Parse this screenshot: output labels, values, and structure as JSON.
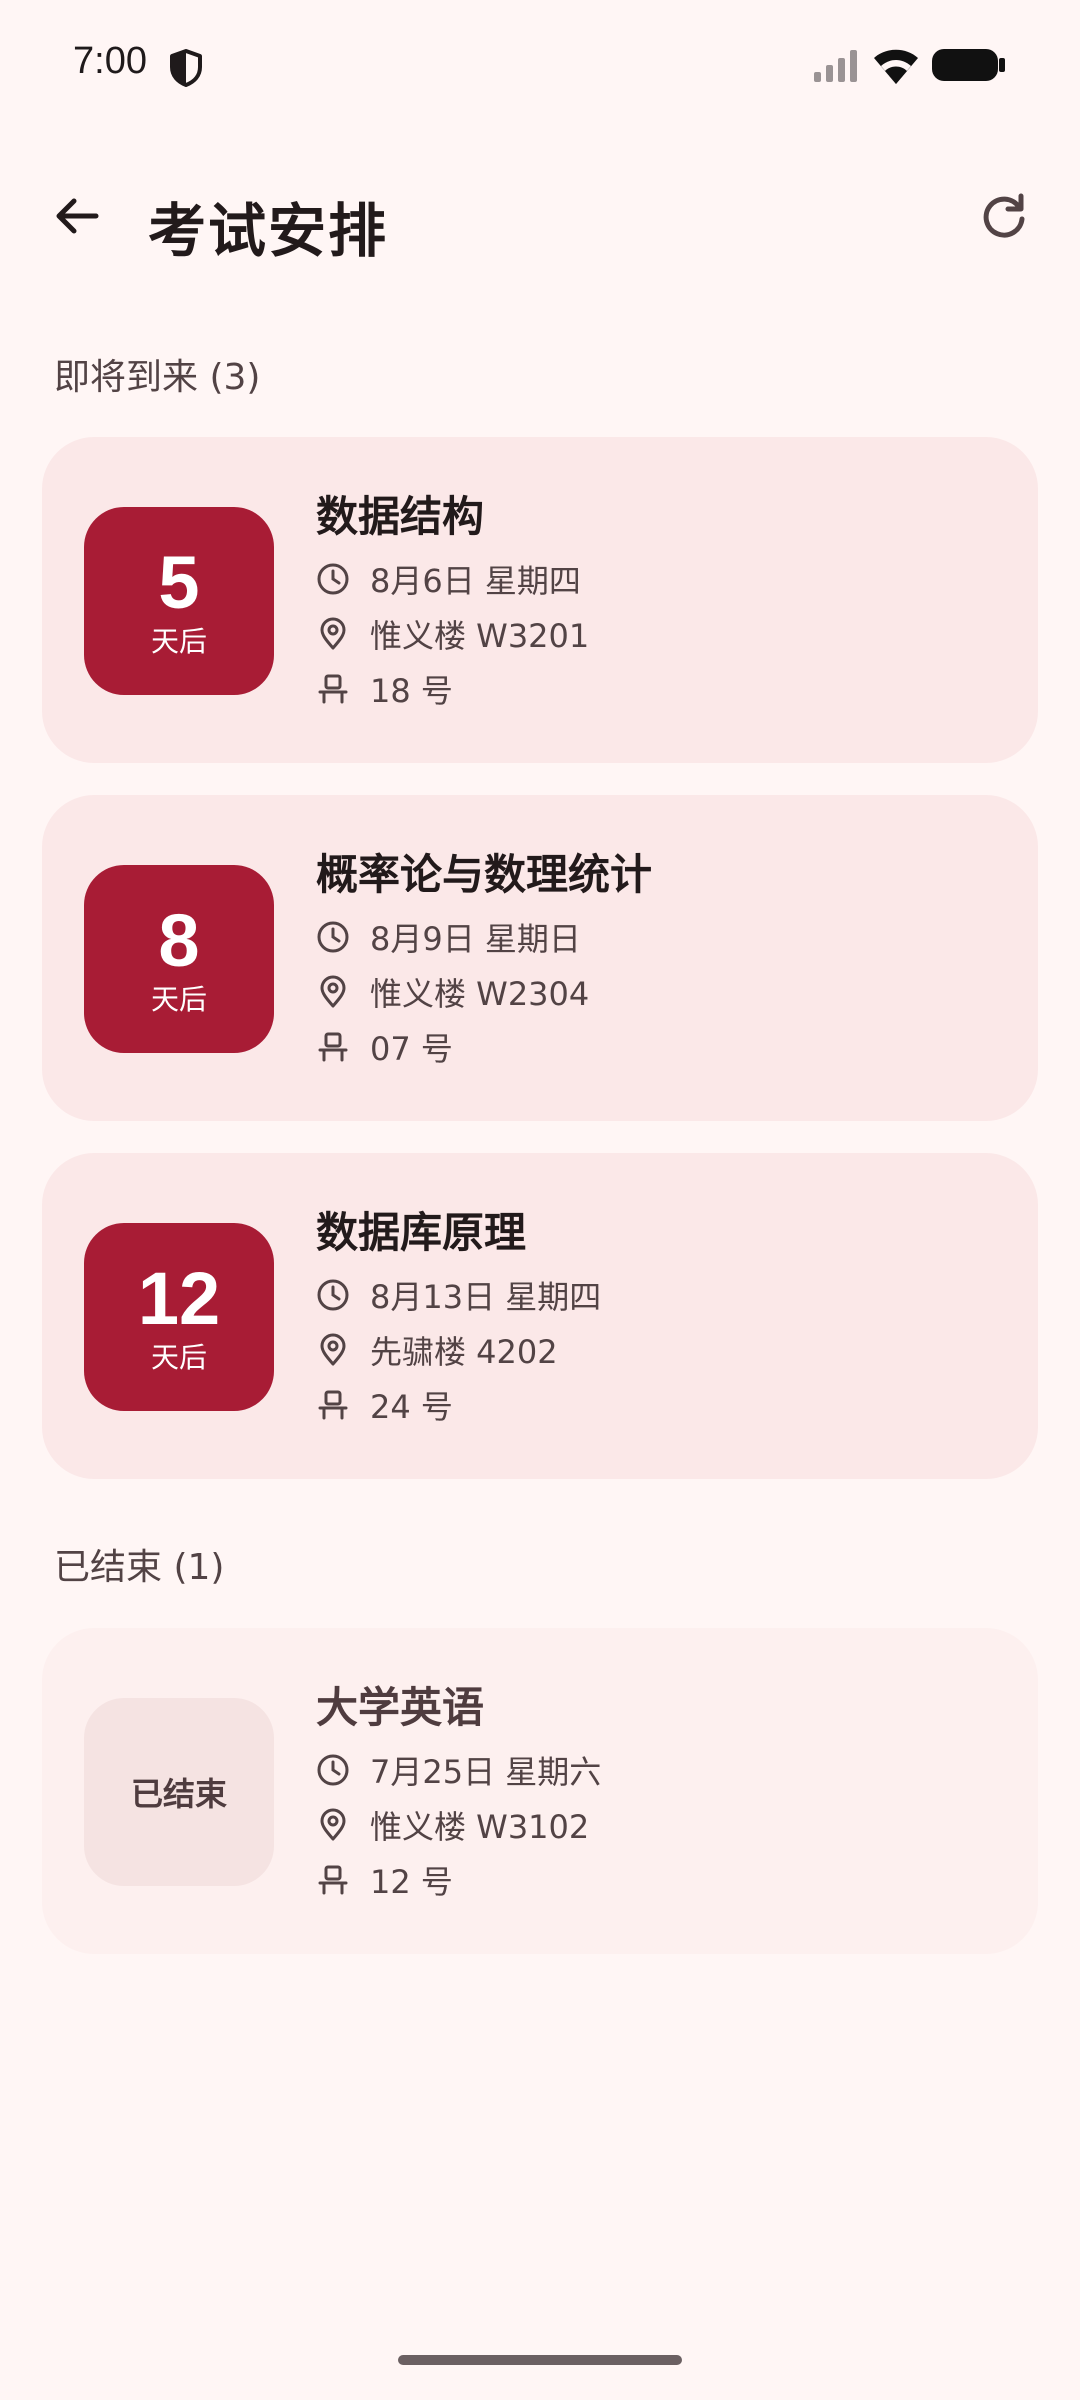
{
  "status_bar": {
    "time": "7:00"
  },
  "app_bar": {
    "title": "考试安排"
  },
  "colors": {
    "background": "#fff6f5",
    "card": "#fbe8e8",
    "card_ended": "#fdf0ef",
    "badge": "#a81c35",
    "badge_ended": "#f5e3e2"
  },
  "sections": {
    "upcoming_header": "即将到来 (3)",
    "ended_header": "已结束 (1)"
  },
  "upcoming": [
    {
      "days": "5",
      "unit": "天后",
      "title": "数据结构",
      "date": "8月6日 星期四",
      "location": "惟义楼 W3201",
      "seat": "18 号"
    },
    {
      "days": "8",
      "unit": "天后",
      "title": "概率论与数理统计",
      "date": "8月9日 星期日",
      "location": "惟义楼 W2304",
      "seat": "07 号"
    },
    {
      "days": "12",
      "unit": "天后",
      "title": "数据库原理",
      "date": "8月13日 星期四",
      "location": "先骕楼 4202",
      "seat": "24 号"
    }
  ],
  "ended": [
    {
      "status": "已结束",
      "title": "大学英语",
      "date": "7月25日 星期六",
      "location": "惟义楼 W3102",
      "seat": "12 号"
    }
  ],
  "icons": {
    "back": "arrow-back-icon",
    "refresh": "refresh-icon",
    "date": "clock-icon",
    "location": "location-pin-icon",
    "seat": "seat-icon"
  }
}
